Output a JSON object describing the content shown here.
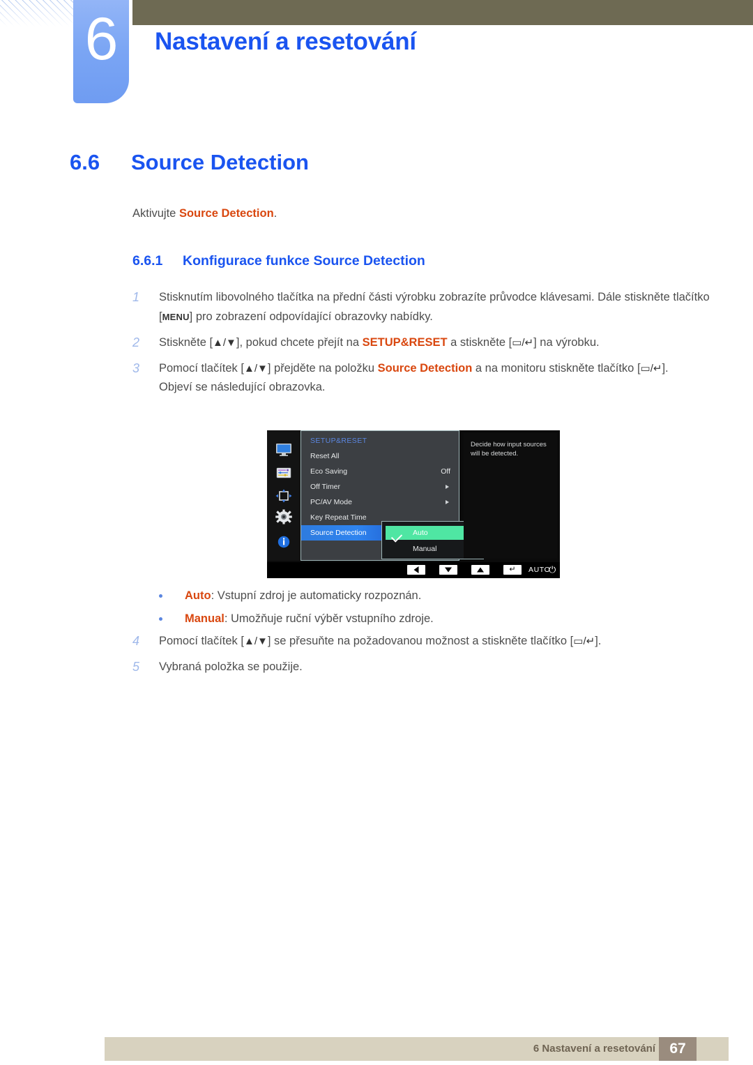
{
  "header": {
    "chapter_number": "6",
    "chapter_title": "Nastavení a resetování"
  },
  "section": {
    "number": "6.6",
    "title": "Source Detection",
    "intro_before": "Aktivujte ",
    "intro_keyword": "Source Detection",
    "intro_after": "."
  },
  "subsection": {
    "number": "6.6.1",
    "title": "Konfigurace funkce Source Detection"
  },
  "steps": [
    {
      "n": "1",
      "parts": [
        {
          "t": "Stisknutím libovolného tlačítka na přední části výrobku zobrazíte průvodce klávesami. Dále stiskněte tlačítko [",
          "style": "plain"
        },
        {
          "t": "MENU",
          "style": "keycap"
        },
        {
          "t": "] pro zobrazení odpovídající obrazovky nabídky.",
          "style": "plain"
        }
      ]
    },
    {
      "n": "2",
      "parts": [
        {
          "t": "Stiskněte [",
          "style": "plain"
        },
        {
          "t": "▲/▼",
          "style": "glyph"
        },
        {
          "t": "], pokud chcete přejít na ",
          "style": "plain"
        },
        {
          "t": "SETUP&RESET",
          "style": "kw"
        },
        {
          "t": " a stiskněte [",
          "style": "plain"
        },
        {
          "t": "▭/↵",
          "style": "glyph"
        },
        {
          "t": "] na výrobku.",
          "style": "plain"
        }
      ]
    },
    {
      "n": "3",
      "parts": [
        {
          "t": "Pomocí tlačítek [",
          "style": "plain"
        },
        {
          "t": "▲/▼",
          "style": "glyph"
        },
        {
          "t": "] přejděte na položku ",
          "style": "plain"
        },
        {
          "t": "Source Detection",
          "style": "kw"
        },
        {
          "t": " a na monitoru stiskněte tlačítko [",
          "style": "plain"
        },
        {
          "t": "▭/↵",
          "style": "glyph"
        },
        {
          "t": "].",
          "style": "plain"
        }
      ],
      "note": "Objeví se následující obrazovka."
    }
  ],
  "steps_after": [
    {
      "n": "4",
      "parts": [
        {
          "t": "Pomocí tlačítek [",
          "style": "plain"
        },
        {
          "t": "▲/▼",
          "style": "glyph"
        },
        {
          "t": "] se přesuňte na požadovanou možnost a stiskněte tlačítko [",
          "style": "plain"
        },
        {
          "t": "▭/↵",
          "style": "glyph"
        },
        {
          "t": "].",
          "style": "plain"
        }
      ]
    },
    {
      "n": "5",
      "parts": [
        {
          "t": "Vybraná položka se použije.",
          "style": "plain"
        }
      ]
    }
  ],
  "osd": {
    "menu_title": "SETUP&RESET",
    "icons": [
      "display-icon",
      "picture-icon",
      "screen-adjust-icon",
      "setup-gear-icon",
      "information-icon"
    ],
    "rows": [
      {
        "label": "Reset All",
        "value": "",
        "arrow": false
      },
      {
        "label": "Eco Saving",
        "value": "Off",
        "arrow": false
      },
      {
        "label": "Off Timer",
        "value": "",
        "arrow": true
      },
      {
        "label": "PC/AV Mode",
        "value": "",
        "arrow": true
      },
      {
        "label": "Key Repeat Time",
        "value": "",
        "arrow": false
      },
      {
        "label": "Source Detection",
        "value": "",
        "arrow": false,
        "selected": true
      }
    ],
    "submenu": [
      {
        "label": "Auto",
        "checked": true
      },
      {
        "label": "Manual",
        "checked": false
      }
    ],
    "description": "Decide how input sources will be detected.",
    "bottom_bar": {
      "back_label": "◀",
      "down_label": "▼",
      "up_label": "▲",
      "enter_label": "↵",
      "auto_label": "AUTO",
      "power_label": "⏻"
    },
    "colors": {
      "selected_row": "#2f84ef",
      "submenu_highlight": "#4fe6a3",
      "menu_title": "#5b86e0",
      "panel_bg": "#3c3f43"
    }
  },
  "bullets": [
    {
      "term": "Auto",
      "desc": ": Vstupní zdroj je automaticky rozpoznán."
    },
    {
      "term": "Manual",
      "desc": ": Umožňuje ruční výběr vstupního zdroje."
    }
  ],
  "footer": {
    "text": "6 Nastavení a resetování",
    "page": "67"
  }
}
